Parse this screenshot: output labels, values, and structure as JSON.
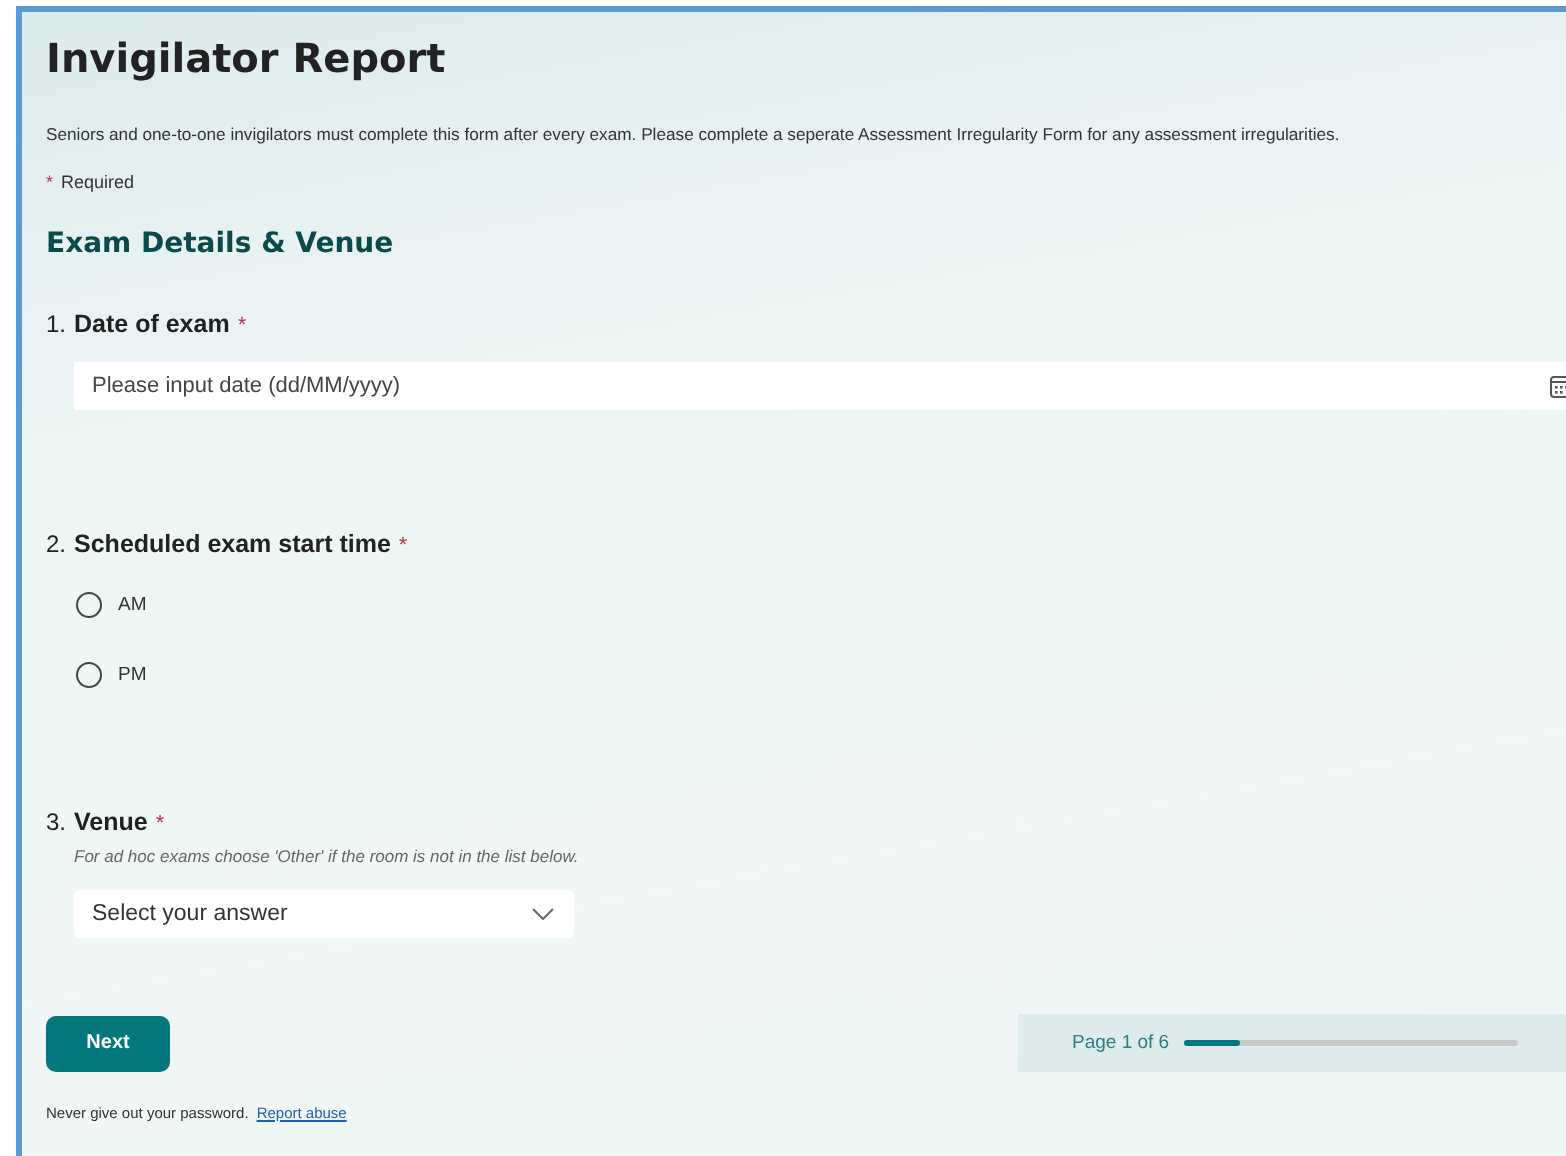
{
  "title": "Invigilator Report",
  "description": "Seniors and one-to-one invigilators must complete this form after every exam. Please complete a seperate Assessment Irregularity Form for any assessment irregularities.",
  "required_note": {
    "mark": "*",
    "label": "Required"
  },
  "section": "Exam Details & Venue",
  "questions": [
    {
      "kind": "date",
      "number": "1.",
      "title": "Date of exam",
      "required_mark": "*",
      "placeholder": "Please input date (dd/MM/yyyy)"
    },
    {
      "kind": "radio",
      "number": "2.",
      "title": "Scheduled exam start time",
      "required_mark": "*",
      "options": [
        {
          "label": "AM",
          "selected": false
        },
        {
          "label": "PM",
          "selected": false
        }
      ]
    },
    {
      "kind": "select",
      "number": "3.",
      "title": "Venue",
      "required_mark": "*",
      "hint": "For ad hoc exams choose 'Other' if the room is not in the list below.",
      "placeholder": "Select your answer"
    }
  ],
  "next_button": "Next",
  "progress": {
    "label": "Page 1 of 6",
    "level": 0.17
  },
  "footer": {
    "text": "Never give out your password.",
    "link": "Report abuse"
  }
}
